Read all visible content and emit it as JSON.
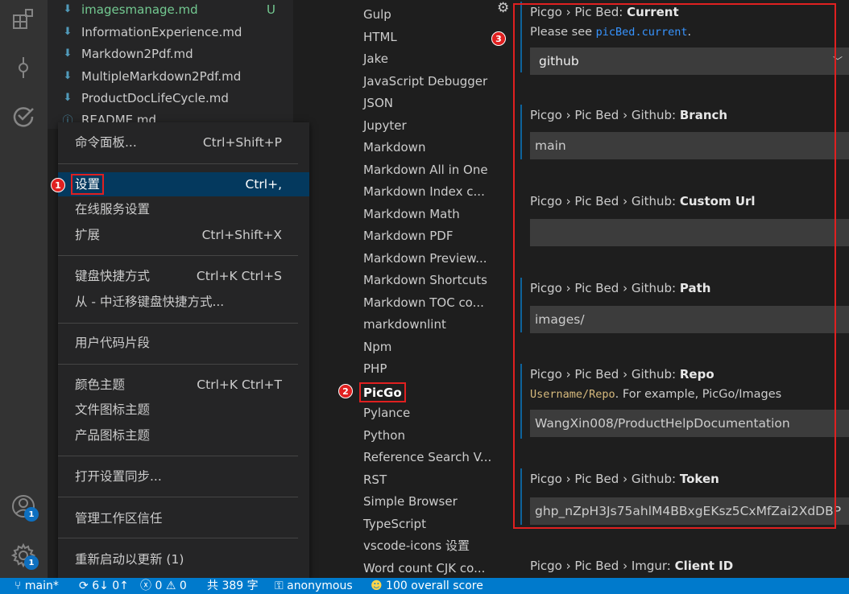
{
  "explorer": {
    "files": [
      {
        "name": "imagesmanage.md",
        "status": "U",
        "icon": "markdown-file-icon"
      },
      {
        "name": "InformationExperience.md",
        "icon": "markdown-file-icon"
      },
      {
        "name": "Markdown2Pdf.md",
        "icon": "markdown-file-icon"
      },
      {
        "name": "MultipleMarkdown2Pdf.md",
        "icon": "markdown-file-icon"
      },
      {
        "name": "ProductDocLifeCycle.md",
        "icon": "markdown-file-icon"
      },
      {
        "name": "README.md",
        "icon": "info-file-icon"
      }
    ]
  },
  "activity": {
    "icons": [
      "extensions-icon",
      "source-control-icon",
      "todo-check-icon",
      "account-icon",
      "manage-gear-icon"
    ],
    "account_badge": "1",
    "manage_badge": "1"
  },
  "menu": {
    "items": [
      {
        "label": "命令面板...",
        "key": "Ctrl+Shift+P"
      },
      {
        "label": "设置",
        "key": "Ctrl+,"
      },
      {
        "label": "在线服务设置",
        "key": ""
      },
      {
        "label": "扩展",
        "key": "Ctrl+Shift+X"
      },
      {
        "label": "键盘快捷方式",
        "key": "Ctrl+K Ctrl+S"
      },
      {
        "label": "从 - 中迁移键盘快捷方式...",
        "key": ""
      },
      {
        "label": "用户代码片段",
        "key": ""
      },
      {
        "label": "颜色主题",
        "key": "Ctrl+K Ctrl+T"
      },
      {
        "label": "文件图标主题",
        "key": ""
      },
      {
        "label": "产品图标主题",
        "key": ""
      },
      {
        "label": "打开设置同步...",
        "key": ""
      },
      {
        "label": "管理工作区信任",
        "key": ""
      },
      {
        "label": "重新启动以更新 (1)",
        "key": ""
      }
    ]
  },
  "toc": {
    "items": [
      "Gulp",
      "HTML",
      "Jake",
      "JavaScript Debugger",
      "JSON",
      "Jupyter",
      "Markdown",
      "Markdown All in One",
      "Markdown Index c...",
      "Markdown Math",
      "Markdown PDF",
      "Markdown Preview...",
      "Markdown Shortcuts",
      "Markdown TOC co...",
      "markdownlint",
      "Npm",
      "PHP",
      "PicGo",
      "Pylance",
      "Python",
      "Reference Search V...",
      "RST",
      "Simple Browser",
      "TypeScript",
      "vscode-icons 设置",
      "Word count CJK co..."
    ],
    "selected": "PicGo"
  },
  "settings": {
    "current": {
      "category": "Picgo › Pic Bed: ",
      "name": "Current",
      "desc_pre": "Please see ",
      "desc_code": "picBed.current",
      "desc_post": ".",
      "value": "github"
    },
    "branch": {
      "category": "Picgo › Pic Bed › Github: ",
      "name": "Branch",
      "value": "main"
    },
    "custom_url": {
      "category": "Picgo › Pic Bed › Github: ",
      "name": "Custom Url",
      "value": ""
    },
    "path": {
      "category": "Picgo › Pic Bed › Github: ",
      "name": "Path",
      "value": "images/"
    },
    "repo": {
      "category": "Picgo › Pic Bed › Github: ",
      "name": "Repo",
      "desc_code": "Username/Repo",
      "desc_post": ". For example, PicGo/Images",
      "value": "WangXin008/ProductHelpDocumentation"
    },
    "token": {
      "category": "Picgo › Pic Bed › Github: ",
      "name": "Token",
      "value": "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"
    },
    "imgur": {
      "category": "Picgo › Pic Bed › Imgur: ",
      "name": "Client ID"
    }
  },
  "markers": [
    "1",
    "2",
    "3"
  ],
  "status": {
    "branch": "main*",
    "sync": "6↓ 0↑",
    "errors": "0",
    "warnings": "0",
    "words": "共 389 字",
    "user": "anonymous",
    "score": "100 overall score"
  },
  "colors": {
    "accent": "#007acc",
    "annotation": "#e02020",
    "highlight": "#04395e"
  }
}
